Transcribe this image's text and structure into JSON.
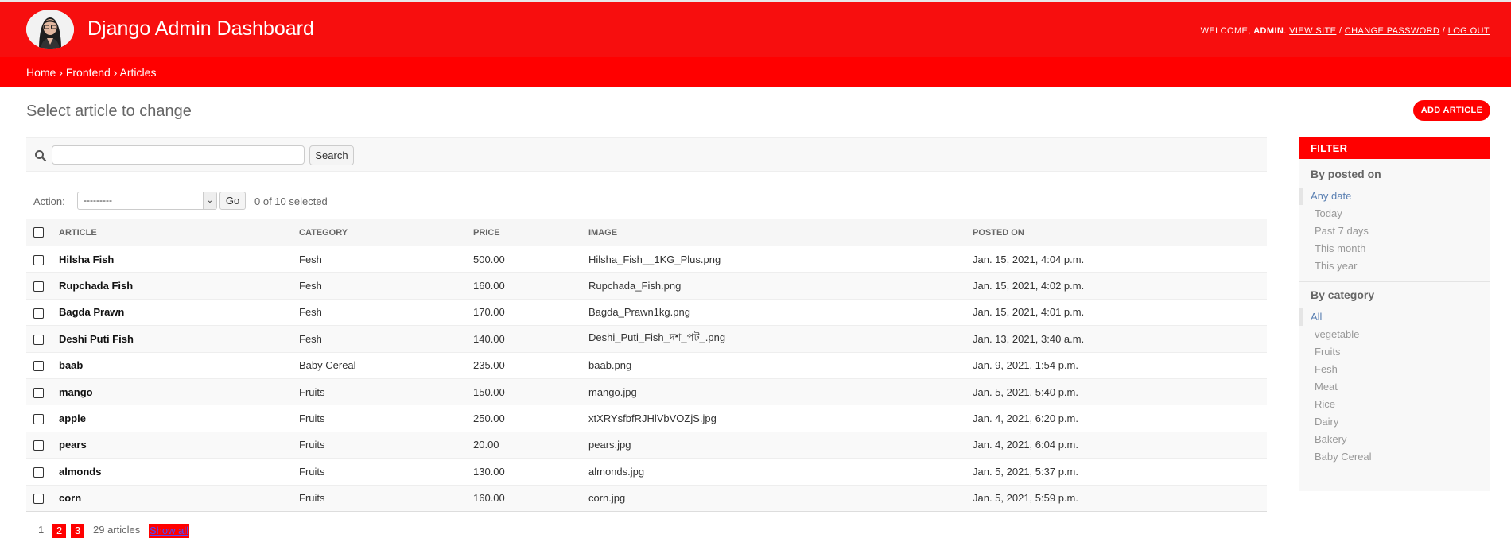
{
  "header": {
    "site_name": "Django Admin Dashboard",
    "welcome": "Welcome,",
    "username": "admin",
    "view_site": "View site",
    "change_password": "Change password",
    "log_out": "Log out",
    "sep": "/"
  },
  "breadcrumbs": {
    "home": "Home",
    "app": "Frontend",
    "model": "Articles",
    "sep": "›"
  },
  "page": {
    "title": "Select article to change",
    "add_button": "ADD ARTICLE"
  },
  "search": {
    "button": "Search",
    "value": ""
  },
  "actions": {
    "label": "Action:",
    "selected_option": "---------",
    "go": "Go",
    "counter": "0 of 10 selected"
  },
  "table": {
    "headers": [
      "Article",
      "Category",
      "Price",
      "Image",
      "Posted on"
    ],
    "rows": [
      {
        "article": "Hilsha Fish",
        "category": "Fesh",
        "price": "500.00",
        "image": "Hilsha_Fish__1KG_Plus.png",
        "posted_on": "Jan. 15, 2021, 4:04 p.m."
      },
      {
        "article": "Rupchada Fish",
        "category": "Fesh",
        "price": "160.00",
        "image": "Rupchada_Fish.png",
        "posted_on": "Jan. 15, 2021, 4:02 p.m."
      },
      {
        "article": "Bagda Prawn",
        "category": "Fesh",
        "price": "170.00",
        "image": "Bagda_Prawn1kg.png",
        "posted_on": "Jan. 15, 2021, 4:01 p.m."
      },
      {
        "article": "Deshi Puti Fish",
        "category": "Fesh",
        "price": "140.00",
        "image": "Deshi_Puti_Fish_দশ_পট_.png",
        "posted_on": "Jan. 13, 2021, 3:40 a.m."
      },
      {
        "article": "baab",
        "category": "Baby Cereal",
        "price": "235.00",
        "image": "baab.png",
        "posted_on": "Jan. 9, 2021, 1:54 p.m."
      },
      {
        "article": "mango",
        "category": "Fruits",
        "price": "150.00",
        "image": "mango.jpg",
        "posted_on": "Jan. 5, 2021, 5:40 p.m."
      },
      {
        "article": "apple",
        "category": "Fruits",
        "price": "250.00",
        "image": "xtXRYsfbfRJHlVbVOZjS.jpg",
        "posted_on": "Jan. 4, 2021, 6:20 p.m."
      },
      {
        "article": "pears",
        "category": "Fruits",
        "price": "20.00",
        "image": "pears.jpg",
        "posted_on": "Jan. 4, 2021, 6:04 p.m."
      },
      {
        "article": "almonds",
        "category": "Fruits",
        "price": "130.00",
        "image": "almonds.jpg",
        "posted_on": "Jan. 5, 2021, 5:37 p.m."
      },
      {
        "article": "corn",
        "category": "Fruits",
        "price": "160.00",
        "image": "corn.jpg",
        "posted_on": "Jan. 5, 2021, 5:59 p.m."
      }
    ]
  },
  "paginator": {
    "current": "1",
    "pages": [
      "2",
      "3"
    ],
    "count": "29 articles",
    "show_all": "Show all"
  },
  "filter": {
    "title": "FILTER",
    "groups": [
      {
        "heading": "By posted on",
        "options": [
          "Any date",
          "Today",
          "Past 7 days",
          "This month",
          "This year"
        ]
      },
      {
        "heading": "By category",
        "options": [
          "All",
          "vegetable",
          "Fruits",
          "Fesh",
          "Meat",
          "Rice",
          "Dairy",
          "Bakery",
          "Baby Cereal"
        ]
      }
    ]
  },
  "colors": {
    "brand": "#f70e0e",
    "link_selected": "#5b80b2"
  }
}
